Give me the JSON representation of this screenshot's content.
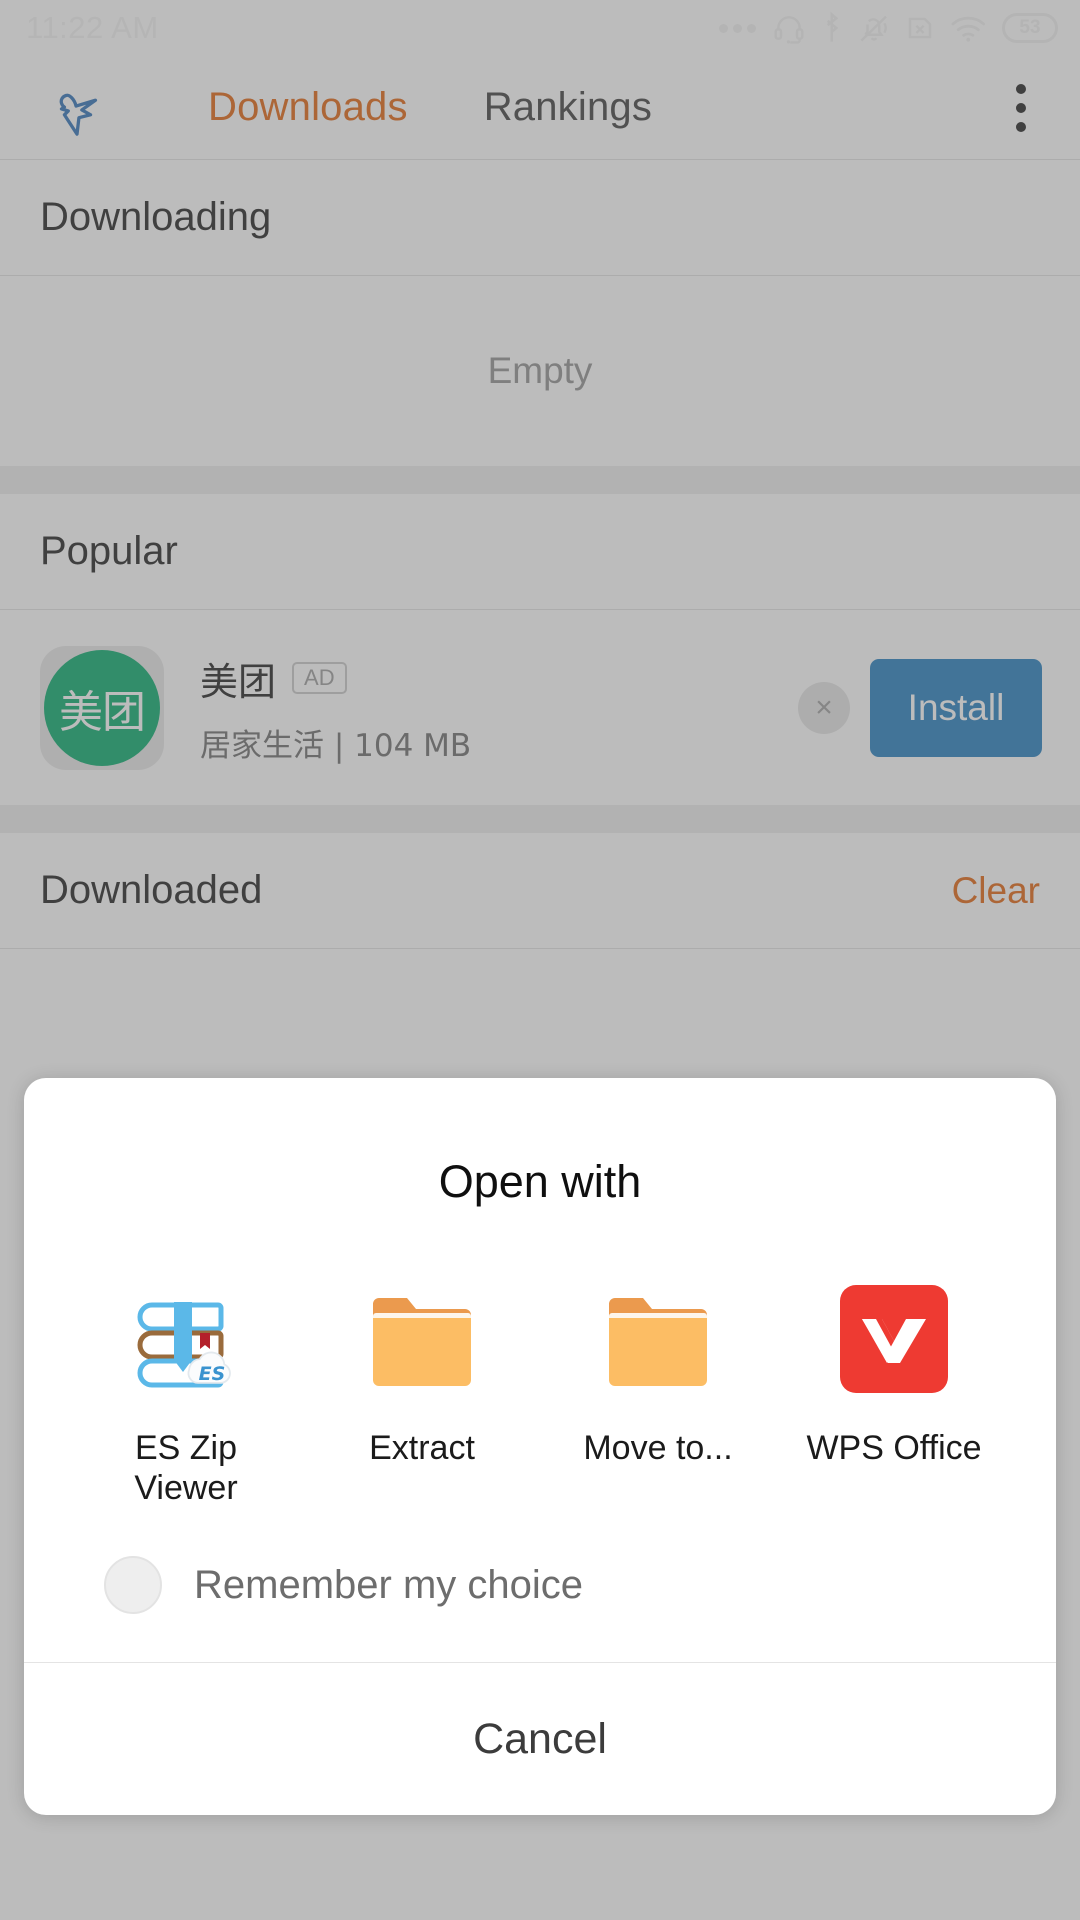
{
  "status_bar": {
    "clock": "11:22 AM",
    "battery_level": "53",
    "icons": [
      "more-dots-icon",
      "headset-icon",
      "bluetooth-icon",
      "mute-bell-icon",
      "sim-missing-icon",
      "wifi-icon",
      "battery-icon"
    ]
  },
  "toolbar": {
    "logo_icon": "bird-logo-icon",
    "tabs": [
      {
        "label": "Downloads",
        "active": true
      },
      {
        "label": "Rankings",
        "active": false
      }
    ],
    "overflow_icon": "overflow-menu-icon"
  },
  "sections": {
    "downloading": {
      "title": "Downloading",
      "empty_text": "Empty"
    },
    "popular": {
      "title": "Popular",
      "ad": {
        "icon_text": "美团",
        "name": "美团",
        "badge": "AD",
        "meta": "居家生活 | 104 MB",
        "close_label": "×",
        "install_label": "Install",
        "icon_color": "#00a868",
        "install_color": "#1f7bbd"
      }
    },
    "downloaded": {
      "title": "Downloaded",
      "action": "Clear"
    }
  },
  "dialog": {
    "title": "Open  with",
    "apps": [
      {
        "label": "ES Zip Viewer",
        "icon": "es-zip-viewer-icon"
      },
      {
        "label": "Extract",
        "icon": "folder-icon"
      },
      {
        "label": "Move to...",
        "icon": "folder-icon"
      },
      {
        "label": "WPS Office",
        "icon": "wps-office-icon"
      }
    ],
    "remember_label": "Remember my choice",
    "remember_checked": false,
    "cancel_label": "Cancel"
  },
  "colors": {
    "accent_orange": "#e2600a",
    "install_blue": "#1f7bbd",
    "folder_orange": "#fcbd64",
    "wps_red": "#ee3a32"
  }
}
